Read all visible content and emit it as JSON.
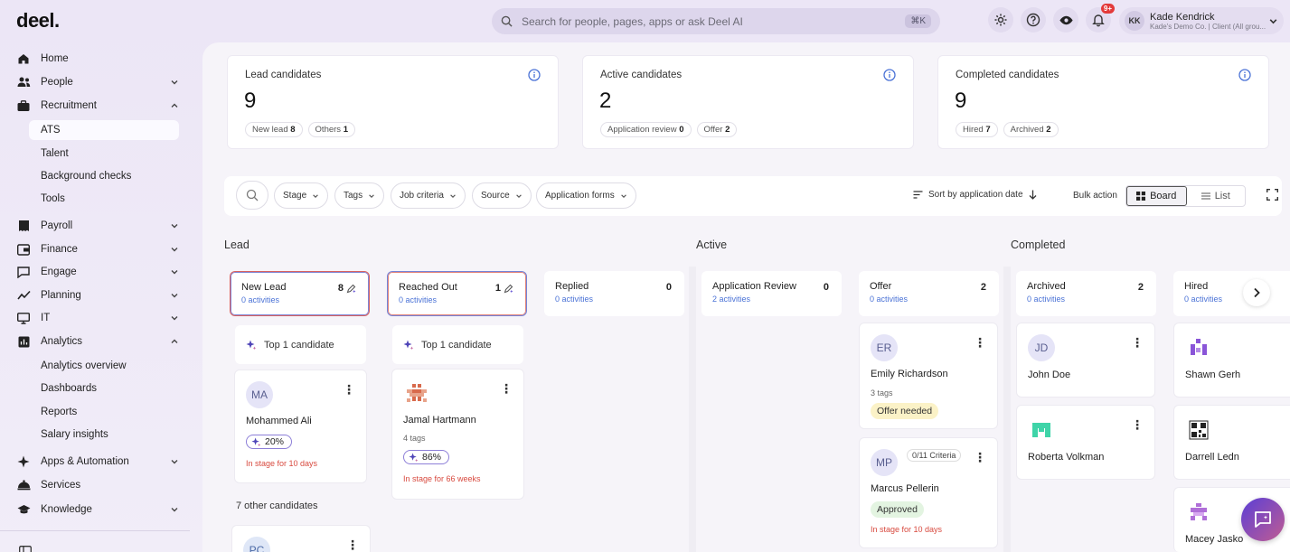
{
  "brand": {
    "logo": "deel."
  },
  "search": {
    "placeholder": "Search for people, pages, apps or ask Deel AI",
    "shortcut": "⌘K"
  },
  "topbar": {
    "notifications_badge": "9+"
  },
  "user": {
    "initials": "KK",
    "name": "Kade Kendrick",
    "subtitle": "Kade's Demo Co. | Client (All grou..."
  },
  "sidebar": {
    "home": "Home",
    "people": "People",
    "recruitment": "Recruitment",
    "recruitment_items": [
      "ATS",
      "Talent",
      "Background checks",
      "Tools"
    ],
    "payroll": "Payroll",
    "finance": "Finance",
    "engage": "Engage",
    "planning": "Planning",
    "it": "IT",
    "analytics": "Analytics",
    "analytics_items": [
      "Analytics overview",
      "Dashboards",
      "Reports",
      "Salary insights"
    ],
    "apps": "Apps & Automation",
    "services": "Services",
    "knowledge": "Knowledge"
  },
  "stats": [
    {
      "title": "Lead candidates",
      "value": "9",
      "chips": [
        {
          "label": "New lead",
          "count": "8"
        },
        {
          "label": "Others",
          "count": "1"
        }
      ]
    },
    {
      "title": "Active candidates",
      "value": "2",
      "chips": [
        {
          "label": "Application review",
          "count": "0"
        },
        {
          "label": "Offer",
          "count": "2"
        }
      ]
    },
    {
      "title": "Completed candidates",
      "value": "9",
      "chips": [
        {
          "label": "Hired",
          "count": "7"
        },
        {
          "label": "Archived",
          "count": "2"
        }
      ]
    }
  ],
  "filters": {
    "stage": "Stage",
    "tags": "Tags",
    "job_criteria": "Job criteria",
    "source": "Source",
    "application_forms": "Application forms",
    "sort": "Sort by application date",
    "bulk": "Bulk action",
    "board": "Board",
    "list": "List"
  },
  "sections": {
    "lead": "Lead",
    "active": "Active",
    "completed": "Completed"
  },
  "columns": [
    {
      "name": "New Lead",
      "activities": "0 activities",
      "count": "8"
    },
    {
      "name": "Reached Out",
      "activities": "0 activities",
      "count": "1"
    },
    {
      "name": "Replied",
      "activities": "0 activities",
      "count": "0"
    },
    {
      "name": "Application Review",
      "activities": "2 activities",
      "count": "0"
    },
    {
      "name": "Offer",
      "activities": "0 activities",
      "count": "2"
    },
    {
      "name": "Archived",
      "activities": "0 activities",
      "count": "2"
    },
    {
      "name": "Hired",
      "activities": "0 activities",
      "count": ""
    }
  ],
  "top_candidate": "Top 1 candidate",
  "cards": {
    "mohammed": {
      "initials": "MA",
      "name": "Mohammed Ali",
      "score": "20%",
      "stage": "In stage for 10 days"
    },
    "jamal": {
      "name": "Jamal Hartmann",
      "tags": "4 tags",
      "score": "86%",
      "stage": "In stage for 66 weeks"
    },
    "pc": {
      "initials": "PC"
    },
    "emily": {
      "initials": "ER",
      "name": "Emily Richardson",
      "tags": "3 tags",
      "pill": "Offer needed"
    },
    "marcus": {
      "initials": "MP",
      "name": "Marcus Pellerin",
      "criteria": "0/11 Criteria",
      "pill": "Approved",
      "stage": "In stage for 10 days"
    },
    "john": {
      "initials": "JD",
      "name": "John Doe"
    },
    "roberta": {
      "name": "Roberta Volkman"
    },
    "shawn": {
      "name": "Shawn Gerh"
    },
    "darrell": {
      "name": "Darrell Ledn"
    },
    "macey": {
      "name": "Macey Jasko"
    }
  },
  "other_candidates": "7 other candidates",
  "colors": {
    "accent": "#5b3fd6",
    "danger": "#d84a3f",
    "link": "#4a72d6"
  }
}
